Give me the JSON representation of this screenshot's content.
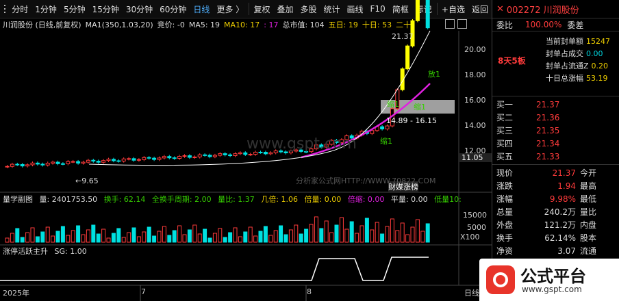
{
  "toolbar": {
    "items": [
      {
        "label": "分时",
        "key": "fenshi"
      },
      {
        "label": "1分钟",
        "key": "1min"
      },
      {
        "label": "5分钟",
        "key": "5min"
      },
      {
        "label": "15分钟",
        "key": "15min"
      },
      {
        "label": "30分钟",
        "key": "30min"
      },
      {
        "label": "60分钟",
        "key": "60min"
      },
      {
        "label": "日线",
        "key": "daily"
      },
      {
        "label": "更多 〉",
        "key": "more"
      },
      {
        "label": "复权",
        "key": "fuquan"
      },
      {
        "label": "叠加",
        "key": "diejia"
      },
      {
        "label": "多股",
        "key": "duogu"
      },
      {
        "label": "统计",
        "key": "tongji"
      },
      {
        "label": "画线",
        "key": "huaxian"
      },
      {
        "label": "F10",
        "key": "f10"
      },
      {
        "label": "简框",
        "key": "jiankuang"
      },
      {
        "label": "标记",
        "key": "biaoji"
      },
      {
        "label": "+自选",
        "key": "zixuan"
      },
      {
        "label": "返回",
        "key": "fanhui"
      }
    ]
  },
  "info": {
    "name": "川润股份 (日线,前复权)",
    "ma1": "MA1(350,1.03,20)",
    "jingjia": "竞价: -0",
    "ma5": "MA5: 19",
    "ma10": "MA10: 17",
    "v17": ": 17",
    "zongshizhi": "总市值: 104",
    "wuri": "五日: 19",
    "shiri": "十日: 53",
    "ershi": "二十"
  },
  "quote": {
    "code": "002272 川润股份",
    "weibi_label": "委比",
    "weibi": "100.00%",
    "weicha_label": "委差",
    "boards": "8天5板",
    "seal_labels": [
      "当前封单额",
      "封单占成交",
      "封单占流通Z",
      "十日总涨幅"
    ],
    "seal_values": [
      "15247",
      "0.00",
      "0.20",
      "53.19"
    ],
    "shiri_val": "13",
    "bids": [
      {
        "label": "买一",
        "price": "21.37"
      },
      {
        "label": "买二",
        "price": "21.36"
      },
      {
        "label": "买三",
        "price": "21.35"
      },
      {
        "label": "买四",
        "price": "21.34"
      },
      {
        "label": "买五",
        "price": "21.33"
      }
    ],
    "stats": [
      {
        "l": "现价",
        "v": "21.37",
        "r": "今开"
      },
      {
        "l": "涨跌",
        "v": "1.94",
        "r": "最高"
      },
      {
        "l": "涨幅",
        "v": "9.98%",
        "r": "最低"
      },
      {
        "l": "总量",
        "v": "240.2万",
        "r": "量比"
      },
      {
        "l": "外盘",
        "v": "121.2万",
        "r": "内盘"
      },
      {
        "l": "换手",
        "v": "62.14%",
        "r": "股本"
      },
      {
        "l": "净资",
        "v": "3.07",
        "r": "流通"
      }
    ]
  },
  "price_axis": [
    "20.00",
    "18.00",
    "16.00",
    "14.00",
    "12.00"
  ],
  "price_tag": "11.05",
  "annotations": {
    "high": "21.37",
    "low": "←9.65",
    "range": "14.89 - 16.15",
    "fang": "放1",
    "suo1": "缩1",
    "suo2": "缩1",
    "suo3": "缩1",
    "kuai": "财媒涨榜",
    "watermark": "www.gspt.com",
    "watermark2": "分析家公式网HTTP://WWW.70822.COM"
  },
  "sub1": {
    "title": "量学副图",
    "liang": "量: 2401753.50",
    "huanshou": "换手: 62.14",
    "quanhuanshou": "全换手周期: 2.00",
    "liangbi": "量比: 1.37",
    "jibei": "几倍: 1.06",
    "beiliang": "倍量: 0.00",
    "beisuo": "倍缩: 0.00",
    "pingliang": "平量: 0.00",
    "diliang": "低量10:",
    "axis": [
      "15000",
      "5000",
      "X100"
    ]
  },
  "sub2": {
    "title": "涨停活跃主升",
    "sg": "SG: 1.00"
  },
  "xaxis": [
    "2025年",
    "7",
    "8",
    "日线"
  ],
  "brand": {
    "name": "公式平台",
    "url": "www.gspt.com"
  },
  "colors": {
    "up": "#ff3b3b",
    "down": "#00e0e0",
    "zt": "#ffff00",
    "green": "#36d000",
    "magenta": "#e020e0"
  }
}
